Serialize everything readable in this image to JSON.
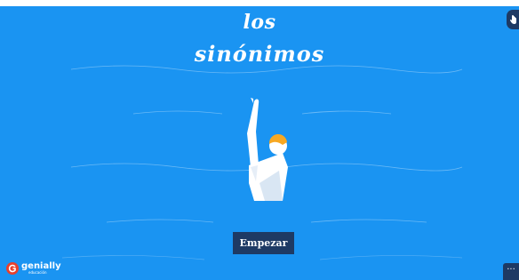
{
  "title": {
    "line1": "los",
    "line2": "sinónimos"
  },
  "start_button": {
    "label": "Empezar"
  },
  "logo": {
    "word": "genially",
    "sub": "educación"
  },
  "menu": {
    "label": "···"
  },
  "icons": {
    "corner": "hand-pointer-icon",
    "logo": "genially-logo-icon",
    "illustration": "swimmer-illustration"
  },
  "colors": {
    "background": "#1a94f2",
    "button": "#1e3a64",
    "text": "#ffffff",
    "swim_cap": "#f7a823"
  }
}
